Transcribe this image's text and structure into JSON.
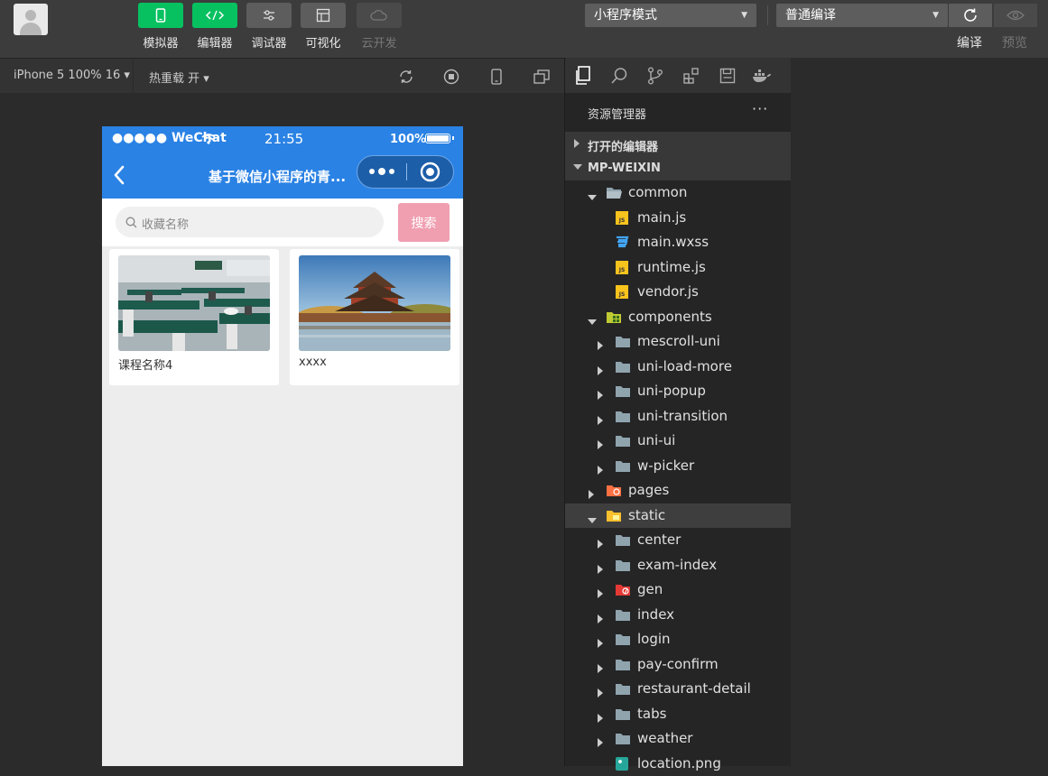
{
  "toolbar": {
    "tools": [
      {
        "label": "模拟器",
        "icon": "phone-icon",
        "style": "green"
      },
      {
        "label": "编辑器",
        "icon": "code-icon",
        "style": "green"
      },
      {
        "label": "调试器",
        "icon": "sliders-icon",
        "style": "gray"
      },
      {
        "label": "可视化",
        "icon": "layout-icon",
        "style": "gray"
      },
      {
        "label": "云开发",
        "icon": "cloud-icon",
        "style": "dim"
      }
    ],
    "mode_select": "小程序模式",
    "compile_select": "普通编译",
    "compile_label": "编译",
    "preview_label": "预览"
  },
  "simbar": {
    "device": "iPhone 5 100% 16 ▾",
    "hot_reload": "热重载 开 ▾"
  },
  "phone": {
    "status_left": "●●●●● WeChat",
    "status_time": "21:55",
    "status_battery": "100%",
    "nav_title": "基于微信小程序的青...",
    "search_placeholder": "收藏名称",
    "search_button": "搜索",
    "cards": [
      {
        "title": "课程名称4",
        "image": "classroom-photo"
      },
      {
        "title": "xxxx",
        "image": "palace-photo"
      }
    ]
  },
  "explorer": {
    "header": "资源管理器",
    "more": "···",
    "sections": [
      "打开的编辑器",
      "MP-WEIXIN"
    ],
    "tree": [
      {
        "label": "common",
        "kind": "folder-open",
        "depth": 1,
        "arrow": "down"
      },
      {
        "label": "main.js",
        "kind": "js",
        "depth": 2
      },
      {
        "label": "main.wxss",
        "kind": "css",
        "depth": 2
      },
      {
        "label": "runtime.js",
        "kind": "js",
        "depth": 2
      },
      {
        "label": "vendor.js",
        "kind": "js",
        "depth": 2
      },
      {
        "label": "components",
        "kind": "components",
        "depth": 1,
        "arrow": "down"
      },
      {
        "label": "mescroll-uni",
        "kind": "folder",
        "depth": 2,
        "arrow": "right"
      },
      {
        "label": "uni-load-more",
        "kind": "folder",
        "depth": 2,
        "arrow": "right"
      },
      {
        "label": "uni-popup",
        "kind": "folder",
        "depth": 2,
        "arrow": "right"
      },
      {
        "label": "uni-transition",
        "kind": "folder",
        "depth": 2,
        "arrow": "right"
      },
      {
        "label": "uni-ui",
        "kind": "folder",
        "depth": 2,
        "arrow": "right"
      },
      {
        "label": "w-picker",
        "kind": "folder",
        "depth": 2,
        "arrow": "right"
      },
      {
        "label": "pages",
        "kind": "pages",
        "depth": 1,
        "arrow": "right"
      },
      {
        "label": "static",
        "kind": "static",
        "depth": 1,
        "arrow": "down",
        "selected": true
      },
      {
        "label": "center",
        "kind": "folder",
        "depth": 2,
        "arrow": "right"
      },
      {
        "label": "exam-index",
        "kind": "folder",
        "depth": 2,
        "arrow": "right"
      },
      {
        "label": "gen",
        "kind": "gen",
        "depth": 2,
        "arrow": "right"
      },
      {
        "label": "index",
        "kind": "folder",
        "depth": 2,
        "arrow": "right"
      },
      {
        "label": "login",
        "kind": "folder",
        "depth": 2,
        "arrow": "right"
      },
      {
        "label": "pay-confirm",
        "kind": "folder",
        "depth": 2,
        "arrow": "right"
      },
      {
        "label": "restaurant-detail",
        "kind": "folder",
        "depth": 2,
        "arrow": "right"
      },
      {
        "label": "tabs",
        "kind": "folder",
        "depth": 2,
        "arrow": "right"
      },
      {
        "label": "weather",
        "kind": "folder",
        "depth": 2,
        "arrow": "right"
      },
      {
        "label": "location.png",
        "kind": "png",
        "depth": 2
      }
    ]
  }
}
